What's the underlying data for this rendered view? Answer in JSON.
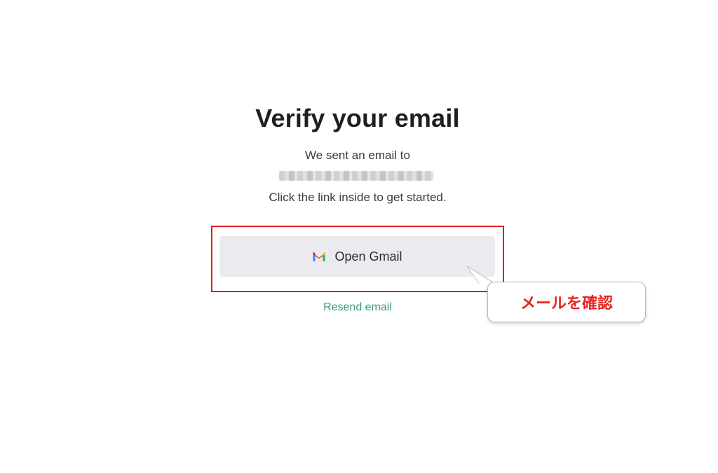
{
  "heading": "Verify your email",
  "message": {
    "line1": "We sent an email to",
    "line2": "Click the link inside to get started."
  },
  "buttons": {
    "open_gmail_label": "Open Gmail",
    "resend_label": "Resend email"
  },
  "annotation": {
    "callout_text": "メールを確認",
    "highlight_color": "#e11d1d",
    "callout_text_color": "#e8241f"
  },
  "colors": {
    "link": "#3a9a78",
    "button_bg": "#ebebef"
  },
  "icons": {
    "gmail": "gmail-icon"
  }
}
